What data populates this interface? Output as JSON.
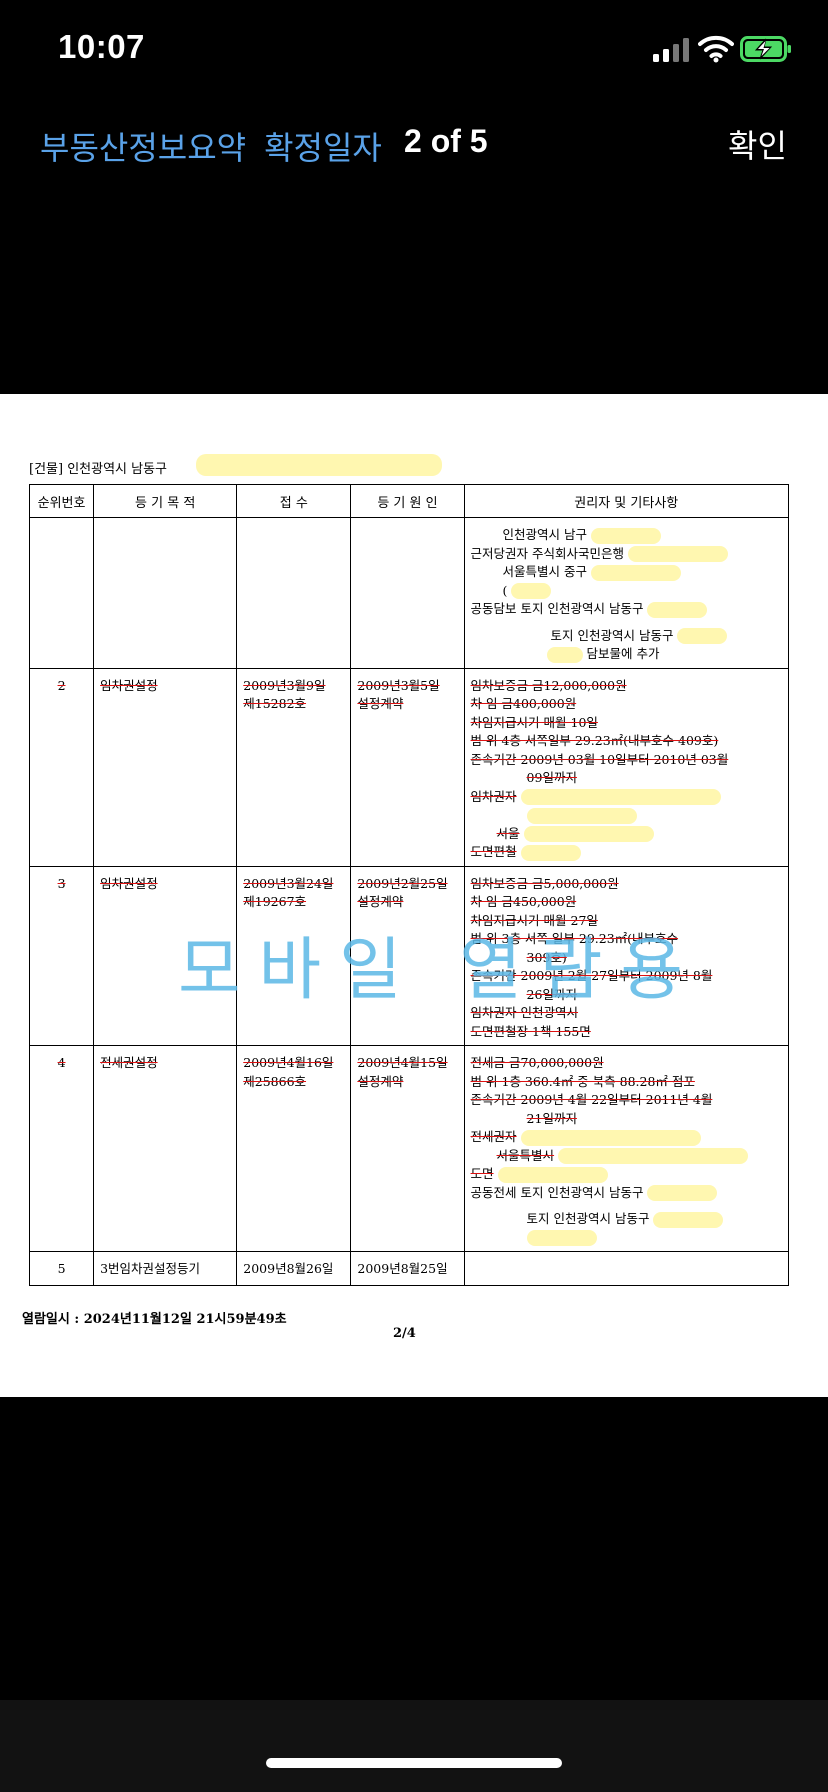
{
  "status": {
    "time": "10:07"
  },
  "nav": {
    "title_part1": "부동산정보요약",
    "title_part2": "확정일자",
    "page_indicator": "2 of 5",
    "confirm_label": "확인"
  },
  "doc": {
    "address_prefix": "[건물] 인천광역시 남동구",
    "table": {
      "headers": [
        "순위번호",
        "등 기 목 적",
        "접  수",
        "등 기 원 인",
        "권리자 및 기타사항"
      ],
      "row1": {
        "lines": [
          "인천광역시 남구",
          "근저당권자  주식회사국민은행",
          "서울특별시 중구",
          "(",
          "공동담보  토지 인천광역시 남동구",
          "토지 인천광역시 남동구",
          "담보물에 추가"
        ]
      },
      "row2": {
        "no": "2",
        "purpose": "임차권설정",
        "receipt_date": "2009년3월9일",
        "receipt_no": "제15282호",
        "cause_date": "2009년3월5일",
        "cause": "설정계약",
        "lines": [
          "임차보증금  금12,000,000원",
          "차  임  금400,000원",
          "차임지급시기  매월 10일",
          "범  위  4층 서쪽일부 29.23㎡(내부호수 409호)",
          "존속기간  2009년 03월 10일부터 2010년 03월",
          "09일까지",
          "임차권자",
          "서울",
          "도면편철"
        ]
      },
      "row3": {
        "no": "3",
        "purpose": "임차권설정",
        "receipt_date": "2009년3월24일",
        "receipt_no": "제19267호",
        "cause_date": "2009년2월25일",
        "cause": "설정계약",
        "lines": [
          "임차보증금  금5,000,000원",
          "차  임  금450,000원",
          "차임지급시기  매월 27일",
          "범  위  3층 서쪽 일부 29.23㎡(내부호수",
          "309호)",
          "존속기간  2009년 2월 27일부터 2009년 8월",
          "26일까지",
          "임차권자  인천광역시",
          "도면편철장 1책 155면"
        ]
      },
      "row4": {
        "no": "4",
        "purpose": "전세권설정",
        "receipt_date": "2009년4월16일",
        "receipt_no": "제25866호",
        "cause_date": "2009년4월15일",
        "cause": "설정계약",
        "lines": [
          "전세금  금70,000,000원",
          "범  위  1층 360.4㎡ 중 북측 88.28㎡ 점포",
          "존속기간  2009년 4월 22일부터 2011년 4월",
          "21일까지",
          "전세권자",
          "서울특별시",
          "도면",
          "공동전세  토지 인천광역시 남동구",
          "토지 인천광역시 남동구"
        ]
      },
      "row5": {
        "no": "5",
        "purpose": "3번임차권설정등기",
        "receipt_date": "2009년8월26일",
        "cause_date": "2009년8월25일"
      }
    },
    "watermark": "모바일 열람용",
    "footer_date": "열람일시 :  2024년11월12일  21시59분49초",
    "page_number": "2/4"
  }
}
